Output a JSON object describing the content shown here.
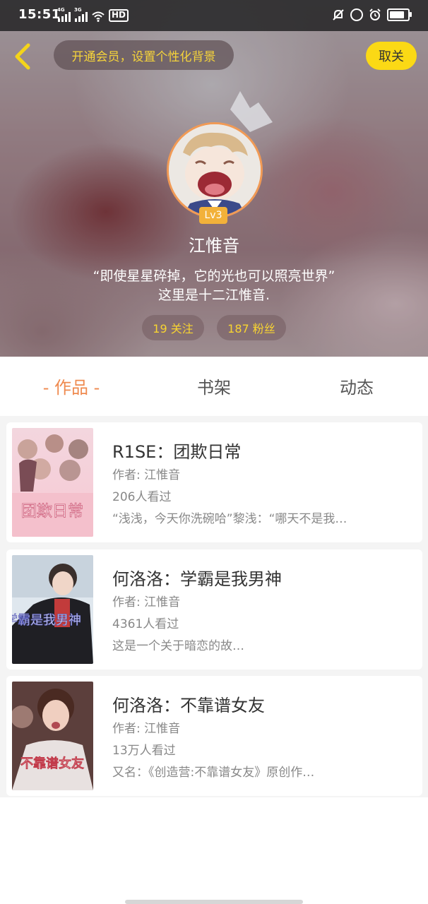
{
  "status_bar": {
    "time": "15:51",
    "network_1": "4G",
    "network_2": "3G",
    "hd_label": "HD",
    "battery_level": 0.85
  },
  "header": {
    "vip_prompt": "开通会员，设置个性化背景",
    "unfollow_label": "取关"
  },
  "profile": {
    "level": "Lv3",
    "name": "江惟音",
    "bio_line1": "“即使星星碎掉，它的光也可以照亮世界”",
    "bio_line2": "这里是十二江惟音.",
    "following": "19 关注",
    "fans": "187 粉丝"
  },
  "tabs": [
    {
      "label": "- 作品 -",
      "active": true
    },
    {
      "label": "书架",
      "active": false
    },
    {
      "label": "动态",
      "active": false
    }
  ],
  "books": [
    {
      "title": "R1SE：团欺日常",
      "author": "作者: 江惟音",
      "views": "206人看过",
      "desc": "“浅浅，今天你洗碗哈”黎浅：“哪天不是我…",
      "cover_text": "团欺日常"
    },
    {
      "title": "何洛洛：学霸是我男神",
      "author": "作者: 江惟音",
      "views": "4361人看过",
      "desc": "这是一个关于暗恋的故…",
      "cover_text": "学霸是我男神"
    },
    {
      "title": "何洛洛：不靠谱女友",
      "author": "作者: 江惟音",
      "views": "13万人看过",
      "desc": "又名：《创造营:不靠谱女友》原创作…",
      "cover_text": "不靠谱女友"
    }
  ],
  "colors": {
    "accent_orange": "#ef8a4f",
    "accent_yellow": "#fbd915",
    "vip_text": "#f6d43a",
    "level_badge": "#f2b13a"
  }
}
